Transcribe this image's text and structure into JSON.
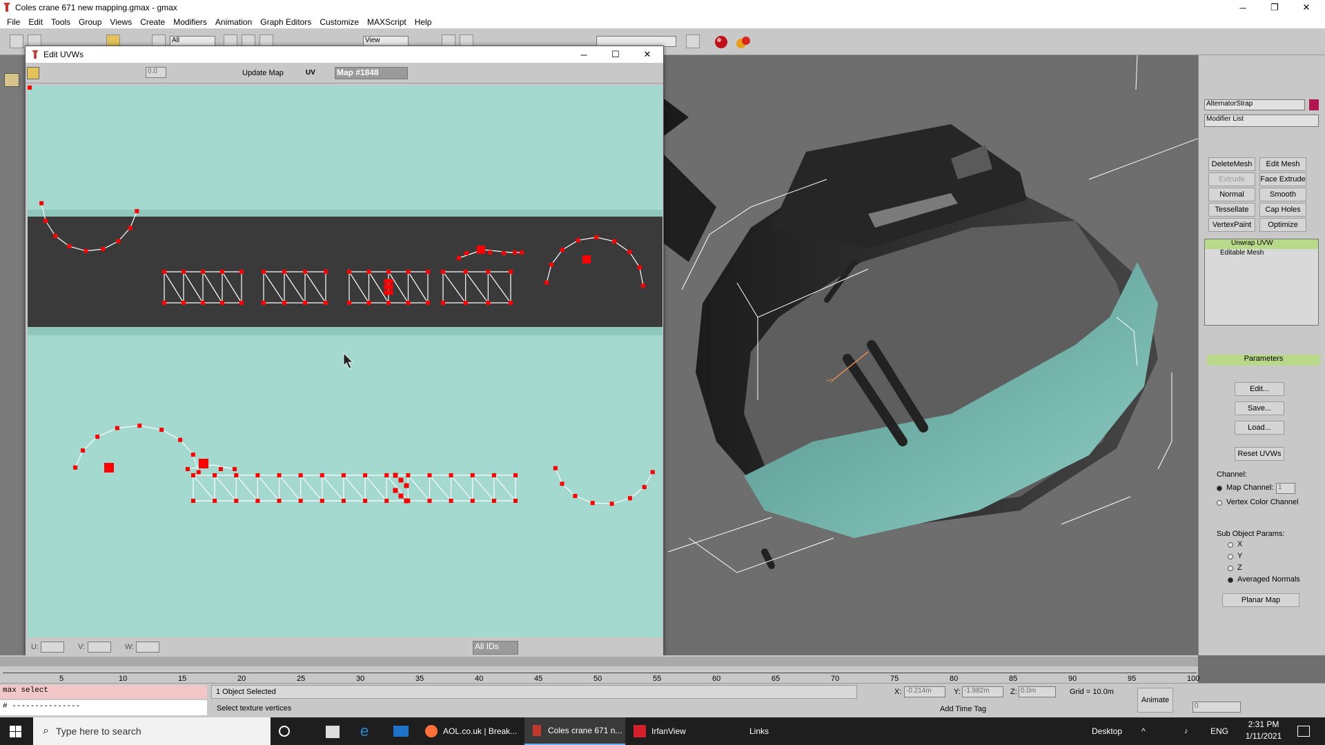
{
  "window": {
    "title": "Coles crane 671 new mapping.gmax - gmax"
  },
  "menu": [
    "File",
    "Edit",
    "Tools",
    "Group",
    "Views",
    "Create",
    "Modifiers",
    "Animation",
    "Graph Editors",
    "Customize",
    "MAXScript",
    "Help"
  ],
  "toolbar": {
    "filter_value": "All",
    "refcoord_value": "View"
  },
  "uvw_window": {
    "title": "Edit UVWs",
    "spinner_value": "0.0",
    "update_map": "Update Map",
    "uv_label": "UV",
    "map_select": "Map #1848",
    "u_label": "U:",
    "v_label": "V:",
    "w_label": "W:",
    "ids_select": "All IDs"
  },
  "command_panel": {
    "object_name": "AlternatorStrap",
    "modifier_list": "Modifier List",
    "buttons": [
      "DeleteMesh",
      "Edit Mesh",
      "Extrude",
      "Face Extrude",
      "Normal",
      "Smooth",
      "Tessellate",
      "Cap Holes",
      "VertexPaint",
      "Optimize"
    ],
    "stack": [
      "Unwrap UVW",
      "Editable Mesh"
    ],
    "rollout_title": "Parameters",
    "edit": "Edit...",
    "save": "Save...",
    "load": "Load...",
    "reset": "Reset UVWs",
    "channel_label": "Channel:",
    "map_channel": "Map Channel:",
    "map_channel_value": "1",
    "vertex_color_channel": "Vertex Color Channel",
    "subobj_label": "Sub Object Params:",
    "axes": [
      "X",
      "Y",
      "Z",
      "Averaged Normals"
    ],
    "planar_map": "Planar Map"
  },
  "timeline": {
    "ticks": [
      "5",
      "10",
      "15",
      "20",
      "25",
      "30",
      "35",
      "40",
      "45",
      "50",
      "55",
      "60",
      "65",
      "70",
      "75",
      "80",
      "85",
      "90",
      "95",
      "100"
    ]
  },
  "status": {
    "script_input": "max select",
    "script_output": "# ---------------",
    "selected": "1 Object Selected",
    "prompt": "Select texture vertices",
    "x_label": "X:",
    "x_value": "-0.214m",
    "y_label": "Y:",
    "y_value": "-1.982m",
    "z_label": "Z:",
    "z_value": "0.0m",
    "grid": "Grid = 10.0m",
    "add_time_tag": "Add Time Tag",
    "animate": "Animate",
    "frame": "0"
  },
  "taskbar": {
    "search_placeholder": "Type here to search",
    "apps": [
      "AOL.co.uk | Break...",
      "Coles crane 671 n...",
      "IrfanView"
    ],
    "links": "Links",
    "desktop": "Desktop",
    "lang": "ENG",
    "time": "2:31 PM",
    "date": "1/11/2021"
  },
  "colors": {
    "uv_background": "#a3d9cf",
    "uv_band": "#3a3a3a",
    "uv_vertex": "#ff0000",
    "model_teal": "#6fb3a8",
    "selected_stack": "#b9d98a"
  }
}
